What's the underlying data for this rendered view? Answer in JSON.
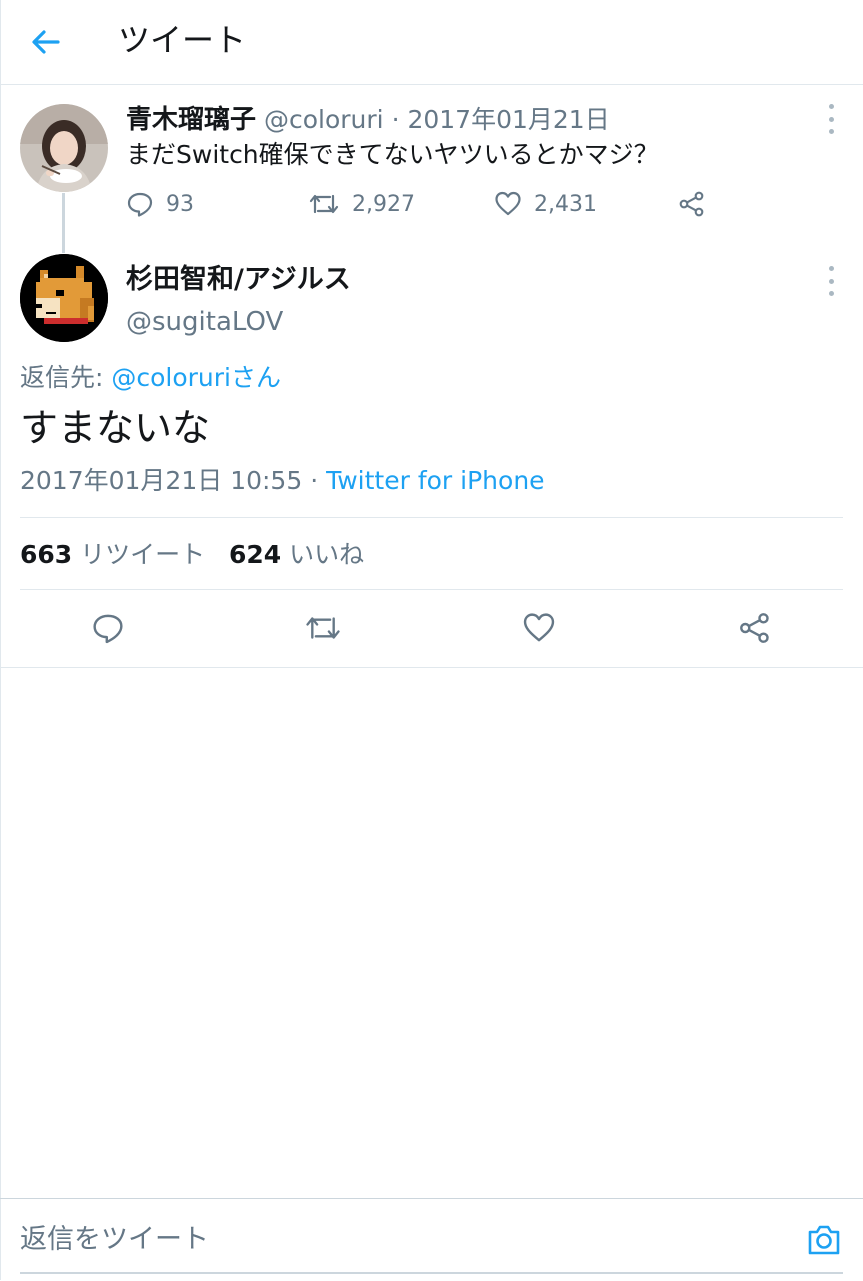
{
  "header": {
    "title": "ツイート"
  },
  "parent_tweet": {
    "name": "青木瑠璃子",
    "handle": "@coloruri",
    "separator": "·",
    "date": "2017年01月21日",
    "text": "まだSwitch確保できてないヤツいるとかマジ？",
    "replies": "93",
    "retweets": "2,927",
    "likes": "2,431"
  },
  "main_tweet": {
    "name": "杉田智和/アジルス",
    "handle": "@sugitaLOV",
    "reply_to_label": "返信先: ",
    "reply_to_handle": "@coloruriさん",
    "text": "すまないな",
    "timestamp": "2017年01月21日 10:55",
    "separator": " · ",
    "source": "Twitter for iPhone",
    "retweet_count": "663",
    "retweet_label": "リツイート",
    "like_count": "624",
    "like_label": "いいね"
  },
  "composer": {
    "placeholder": "返信をツイート"
  },
  "colors": {
    "accent": "#1da1f2",
    "muted": "#657786",
    "divider": "#e1e8ed"
  }
}
